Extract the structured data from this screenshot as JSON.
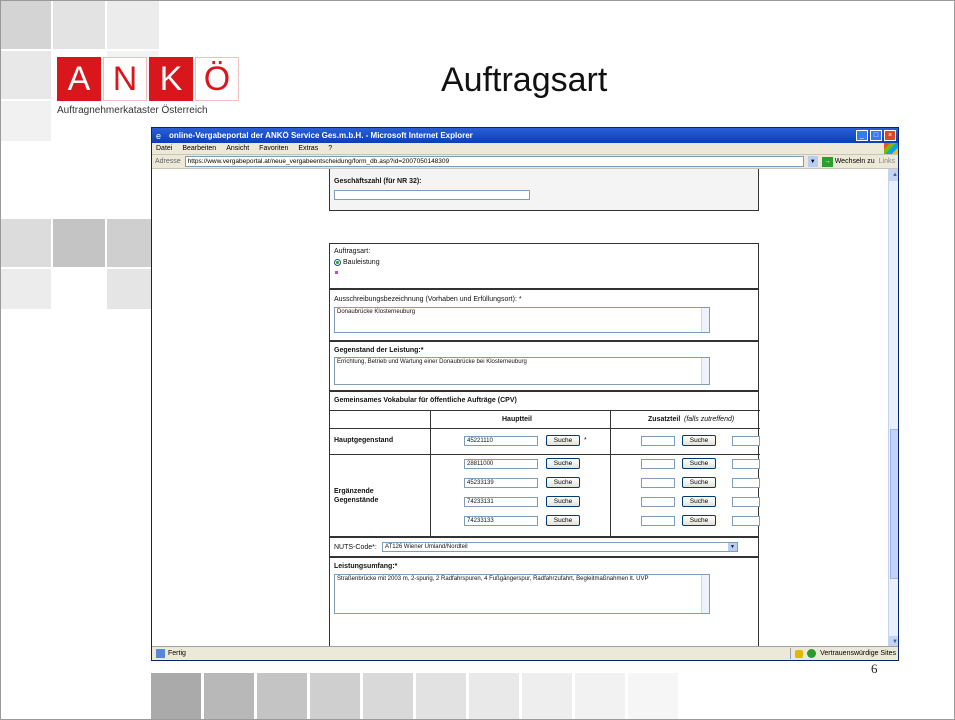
{
  "slide": {
    "title": "Auftragsart",
    "page_number": "6",
    "logo_letters": [
      "A",
      "N",
      "K",
      "Ö"
    ],
    "logo_subtitle": "Auftragnehmerkataster Österreich",
    "colors": {
      "brand_red": "#d9161c",
      "xp_blue": "#0b3fb5",
      "form_border": "#333333"
    }
  },
  "browser": {
    "title": "online-Vergabeportal der ANKÖ Service Ges.m.b.H. - Microsoft Internet Explorer",
    "menu": [
      "Datei",
      "Bearbeiten",
      "Ansicht",
      "Favoriten",
      "Extras",
      "?"
    ],
    "address_label": "Adresse",
    "address_url": "https://www.vergabeportal.at/neue_vergabeentscheidung/form_db.asp?id=2007050148309",
    "go_label": "Wechseln zu",
    "links_label": "Links",
    "status_text": "Fertig",
    "zone_text": "Vertrauenswürdige Sites",
    "icons": [
      "ie-icon",
      "minimize-icon",
      "maximize-icon",
      "close-icon",
      "windows-logo-icon",
      "go-arrow-icon",
      "lock-icon",
      "trusted-zone-icon"
    ]
  },
  "form": {
    "geschaeftszahl_label": "Geschäftszahl (für NR 32):",
    "geschaeftszahl_value": "",
    "auftragsart_label": "Auftragsart:",
    "auftragsart_option": "Bauleistung",
    "ausschreibung_label": "Ausschreibungsbezeichnung (Vorhaben und Erfüllungsort): *",
    "ausschreibung_value": "Donaubrücke Klosterneuburg",
    "gegenstand_label": "Gegenstand der Leistung:*",
    "gegenstand_value": "Errichtung, Betrieb und Wartung einer Donaubrücke bei Klosterneuburg",
    "cpv_title": "Gemeinsames Vokabular für öffentliche Aufträge (CPV)",
    "cpv_hauptteil": "Hauptteil",
    "cpv_zusatzteil": "Zusatzteil",
    "cpv_zusatzteil_hint": "(falls zutreffend)",
    "hauptgegenstand_label": "Hauptgegenstand",
    "hauptgegenstand_code": "45221110",
    "ergaenzende_label_1": "Ergänzende",
    "ergaenzende_label_2": "Gegenstände",
    "ergaenzende_codes": [
      "28811000",
      "45233139",
      "74233131",
      "74233133"
    ],
    "search_label": "Suche",
    "required_marker": "*",
    "nuts_label": "NUTS-Code*:",
    "nuts_value": "AT126 Wiener Umland/Nordteil",
    "leistungsumfang_label": "Leistungsumfang:*",
    "leistungsumfang_value": "Straßenbrücke mit 2003 m, 2-spurig, 2 Radfahrspuren, 4 Fußgängerspur, Radfahrzufahrt, Begleitmaßnahmen lt. UVP"
  }
}
